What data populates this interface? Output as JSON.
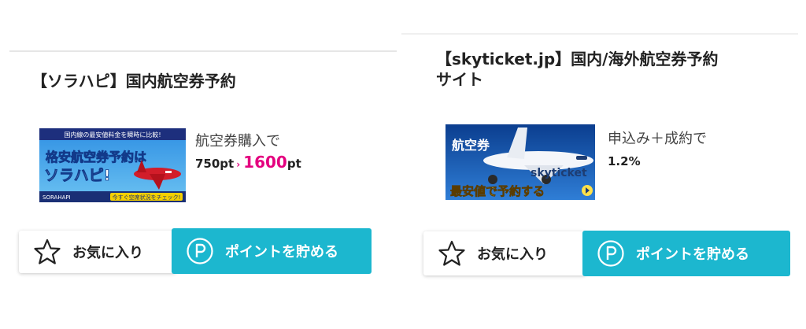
{
  "colors": {
    "accent": "#1cb7cf",
    "highlight": "#e4007f",
    "text": "#222222"
  },
  "cards": [
    {
      "title": "【ソラハピ】国内航空券予約",
      "banner": {
        "headline": "国内線の最安値料金を瞬時に比較!",
        "main_line1": "格安航空券予約は",
        "main_line2": "ソラハピ!",
        "brand": "SORAHAPI",
        "footer": "今すぐ空席状況をチェック!"
      },
      "condition": "航空券購入で",
      "reward_old": "750pt",
      "reward_new": "1600",
      "reward_unit": "pt",
      "favorite_label": "お気に入り",
      "point_label": "ポイントを貯める",
      "icons": {
        "favorite": "star-icon",
        "point": "point-p-icon",
        "arrow": "arrow-right-icon"
      }
    },
    {
      "title_line1": "【skyticket.jp】国内/海外航空券予約",
      "title_line2": "サイト",
      "banner": {
        "tag": "航空券",
        "brand": "skyticket",
        "footer": "最安値で予約する"
      },
      "condition": "申込み＋成約で",
      "reward": "1.2%",
      "favorite_label": "お気に入り",
      "point_label": "ポイントを貯める",
      "icons": {
        "favorite": "star-icon",
        "point": "point-p-icon",
        "go": "circle-arrow-icon"
      }
    }
  ]
}
